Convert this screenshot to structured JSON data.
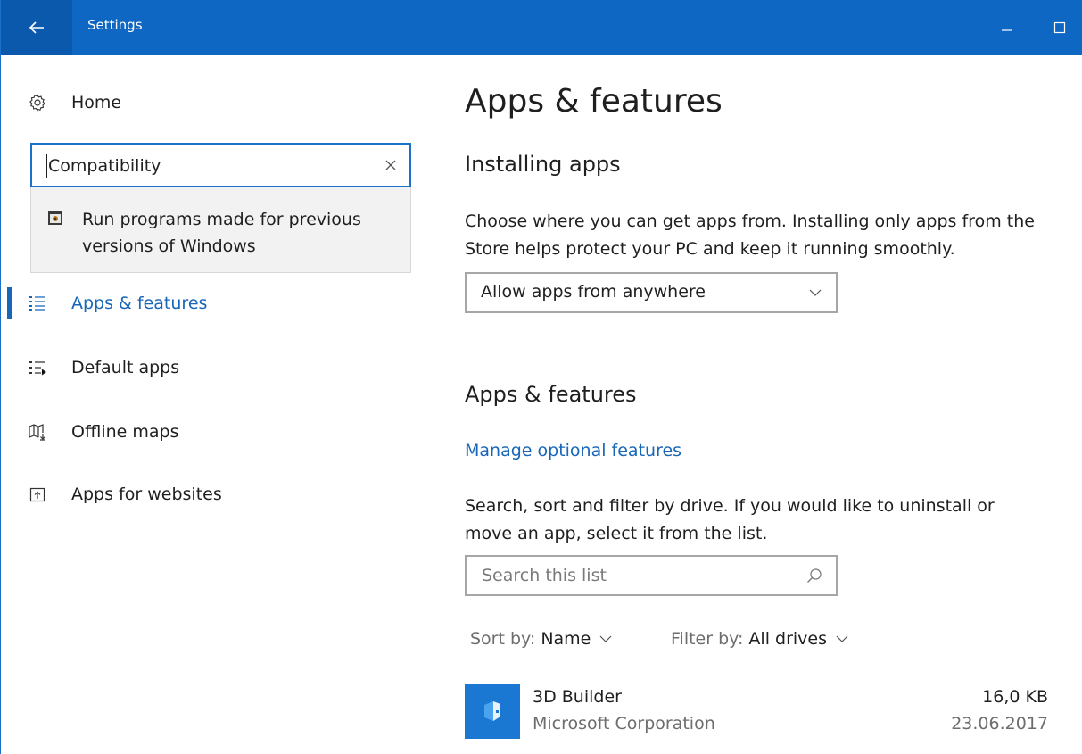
{
  "window": {
    "title": "Settings",
    "accent": "#0f67c4",
    "back_icon": "back-arrow-icon",
    "minimize_icon": "minimize-icon",
    "maximize_icon": "maximize-icon"
  },
  "sidebar": {
    "home_label": "Home",
    "search": {
      "value": "Compatibility"
    },
    "suggestion": {
      "text": "Run programs made for previous versions of Windows"
    },
    "items": [
      {
        "label": "Apps & features",
        "icon": "apps-list-icon",
        "active": true
      },
      {
        "label": "Default apps",
        "icon": "default-apps-icon",
        "active": false
      },
      {
        "label": "Offline maps",
        "icon": "map-download-icon",
        "active": false
      },
      {
        "label": "Apps for websites",
        "icon": "open-in-app-icon",
        "active": false
      }
    ]
  },
  "main": {
    "title": "Apps & features",
    "installing": {
      "heading": "Installing apps",
      "description": "Choose where you can get apps from. Installing only apps from the Store helps protect your PC and keep it running smoothly.",
      "dropdown_value": "Allow apps from anywhere"
    },
    "apps_features": {
      "heading": "Apps & features",
      "link": "Manage optional features",
      "description": "Search, sort and filter by drive. If you would like to uninstall or move an app, select it from the list.",
      "search_placeholder": "Search this list",
      "sort_label": "Sort by:",
      "sort_value": "Name",
      "filter_label": "Filter by:",
      "filter_value": "All drives"
    },
    "apps": [
      {
        "name": "3D Builder",
        "publisher": "Microsoft Corporation",
        "size": "16,0 KB",
        "date": "23.06.2017"
      }
    ]
  }
}
